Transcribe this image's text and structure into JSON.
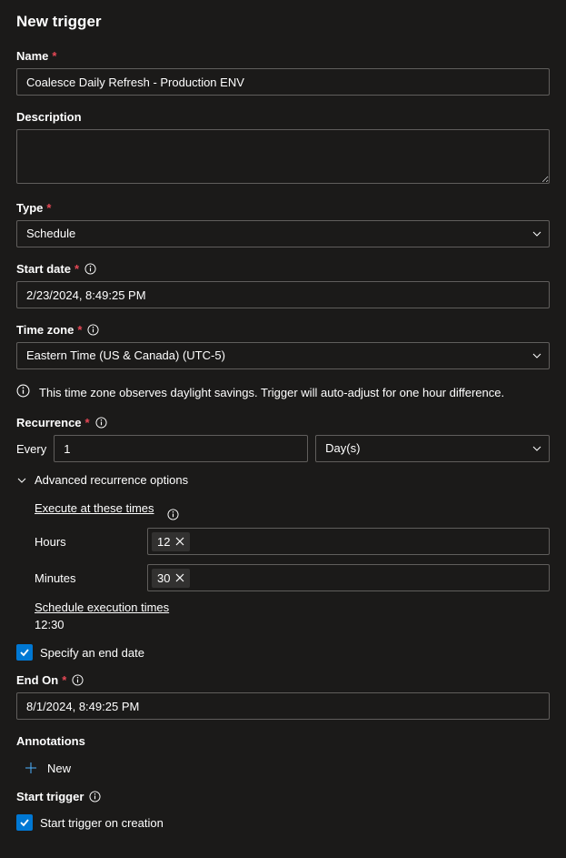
{
  "pageTitle": "New trigger",
  "name": {
    "label": "Name",
    "value": "Coalesce Daily Refresh - Production ENV"
  },
  "description": {
    "label": "Description",
    "value": ""
  },
  "type": {
    "label": "Type",
    "value": "Schedule"
  },
  "startDate": {
    "label": "Start date",
    "value": "2/23/2024, 8:49:25 PM"
  },
  "timeZone": {
    "label": "Time zone",
    "value": "Eastern Time (US & Canada) (UTC-5)"
  },
  "dstNotice": "This time zone observes daylight savings. Trigger will auto-adjust for one hour difference.",
  "recurrence": {
    "label": "Recurrence",
    "everyLabel": "Every",
    "everyValue": "1",
    "unit": "Day(s)"
  },
  "advanced": {
    "header": "Advanced recurrence options",
    "executeTitle": "Execute at these times",
    "hoursLabel": "Hours",
    "hoursValue": "12",
    "minutesLabel": "Minutes",
    "minutesValue": "30",
    "scheduleTitle": "Schedule execution times",
    "scheduleValue": "12:30"
  },
  "specifyEndDate": {
    "label": "Specify an end date",
    "checked": true
  },
  "endOn": {
    "label": "End On",
    "value": "8/1/2024, 8:49:25 PM"
  },
  "annotations": {
    "label": "Annotations",
    "newLabel": "New"
  },
  "startTrigger": {
    "label": "Start trigger",
    "checkboxLabel": "Start trigger on creation",
    "checked": true
  }
}
